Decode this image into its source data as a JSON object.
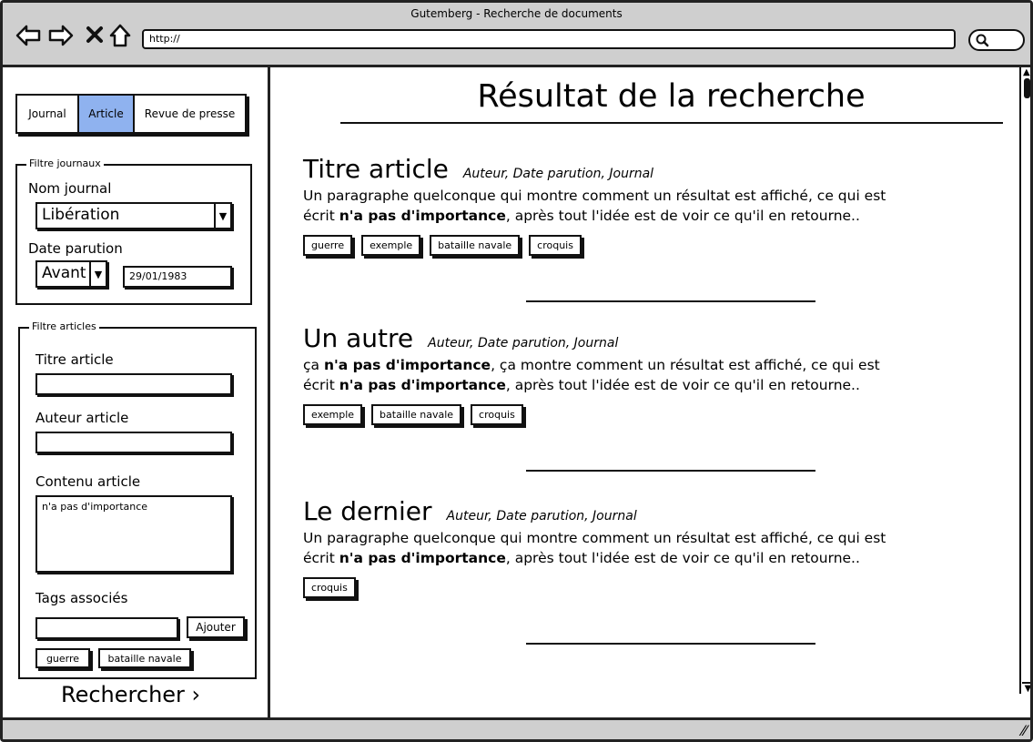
{
  "window": {
    "title": "Gutemberg - Recherche de documents"
  },
  "browser": {
    "url": "http://"
  },
  "icons": {
    "back": "left-arrow-icon",
    "forward": "right-arrow-icon",
    "stop": "close-icon",
    "home": "home-icon",
    "search": "search-icon"
  },
  "sidebar": {
    "tabs": [
      {
        "label": "Journal",
        "active": false
      },
      {
        "label": "Article",
        "active": true
      },
      {
        "label": "Revue de presse",
        "active": false
      }
    ],
    "accent_color": "#8fb2ef",
    "journal_filter": {
      "legend": "Filtre journaux",
      "name_label": "Nom journal",
      "name_value": "Libération",
      "date_label": "Date parution",
      "date_operator": "Avant",
      "date_value": "29/01/1983"
    },
    "article_filter": {
      "legend": "Filtre articles",
      "title_label": "Titre article",
      "title_value": "",
      "author_label": "Auteur article",
      "author_value": "",
      "content_label": "Contenu article",
      "content_value": "n'a pas d'importance",
      "tags_label": "Tags associés",
      "tag_input_value": "",
      "add_button": "Ajouter",
      "tags": [
        "guerre",
        "bataille navale"
      ]
    },
    "search_button": "Rechercher ›"
  },
  "main": {
    "title": "Résultat de la recherche",
    "results": [
      {
        "title": "Titre article",
        "meta": "Auteur, Date parution, Journal",
        "body_pre": "Un paragraphe quelconque qui montre comment un résultat est affiché, ce qui est écrit ",
        "body_bold": "n'a pas d'importance",
        "body_post": ", après tout l'idée est de voir ce qu'il en retourne..",
        "tags": [
          "guerre",
          "exemple",
          "bataille navale",
          "croquis"
        ]
      },
      {
        "title": "Un autre",
        "meta": "Auteur, Date parution, Journal",
        "body_pre": "ça ",
        "body_bold": "n'a pas d'importance",
        "body_mid": ", ça montre comment un résultat est affiché, ce qui est écrit ",
        "body_bold2": "n'a pas d'importance",
        "body_post": ", après tout l'idée est de voir ce qu'il en retourne..",
        "tags": [
          "exemple",
          "bataille navale",
          "croquis"
        ]
      },
      {
        "title": "Le dernier",
        "meta": "Auteur, Date parution, Journal",
        "body_pre": "Un paragraphe quelconque qui montre comment un résultat est affiché, ce qui est écrit ",
        "body_bold": "n'a pas d'importance",
        "body_post": ", après tout l'idée est de voir ce qu'il en retourne..",
        "tags": [
          "croquis"
        ]
      }
    ]
  }
}
